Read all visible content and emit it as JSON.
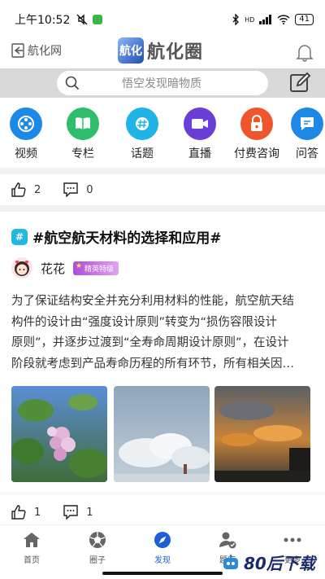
{
  "status_bar": {
    "time": "上午10:52",
    "network": "HD",
    "battery": "41"
  },
  "header": {
    "back_label": "航化网",
    "logo_mark": "航化",
    "logo_text": "航化圈"
  },
  "search": {
    "placeholder": "悟空发现暗物质"
  },
  "quick_nav": {
    "items": [
      {
        "label": "视频",
        "icon": "film-reel-icon",
        "color": "#1e88e5"
      },
      {
        "label": "专栏",
        "icon": "open-book-icon",
        "color": "#2ebd6b"
      },
      {
        "label": "话题",
        "icon": "hashtag-icon",
        "color": "#1fb3e8"
      },
      {
        "label": "直播",
        "icon": "video-camera-icon",
        "color": "#6a3fd8"
      },
      {
        "label": "付费咨询",
        "icon": "lock-icon",
        "color": "#f0562d"
      },
      {
        "label": "问答",
        "icon": "chat-icon",
        "color": "#1e88e5"
      }
    ]
  },
  "prev_post_actions": {
    "likes": "2",
    "comments": "0"
  },
  "post": {
    "title": "#航空航天材料的选择和应用#",
    "topic_icon": "#",
    "author": "花花",
    "badge": "精英特级",
    "body_lines": [
      "为了保证结构安全并充分利用材料的性能，航空航天结",
      "构件的设计由“强度设计原则”转变为“损伤容限设计",
      "原则”，并逐步过渡到“全寿命周期设计原则”，在设计",
      "阶段就考虑到产品寿命历程的所有环节，所有相关因…"
    ],
    "likes": "1",
    "comments": "1"
  },
  "bottom_nav": {
    "tabs": [
      {
        "label": "首页",
        "icon": "home-icon"
      },
      {
        "label": "圈子",
        "icon": "aperture-icon"
      },
      {
        "label": "发现",
        "icon": "compass-icon",
        "active": true
      },
      {
        "label": "题库",
        "icon": "user-check-icon"
      },
      {
        "label": "更多",
        "icon": "more-dots-icon"
      }
    ]
  },
  "watermark": {
    "text": "80后下载"
  },
  "colors": {
    "accent": "#1e5fd9",
    "search_strip": "#d9d9d9",
    "badge": "#b04bd6"
  }
}
